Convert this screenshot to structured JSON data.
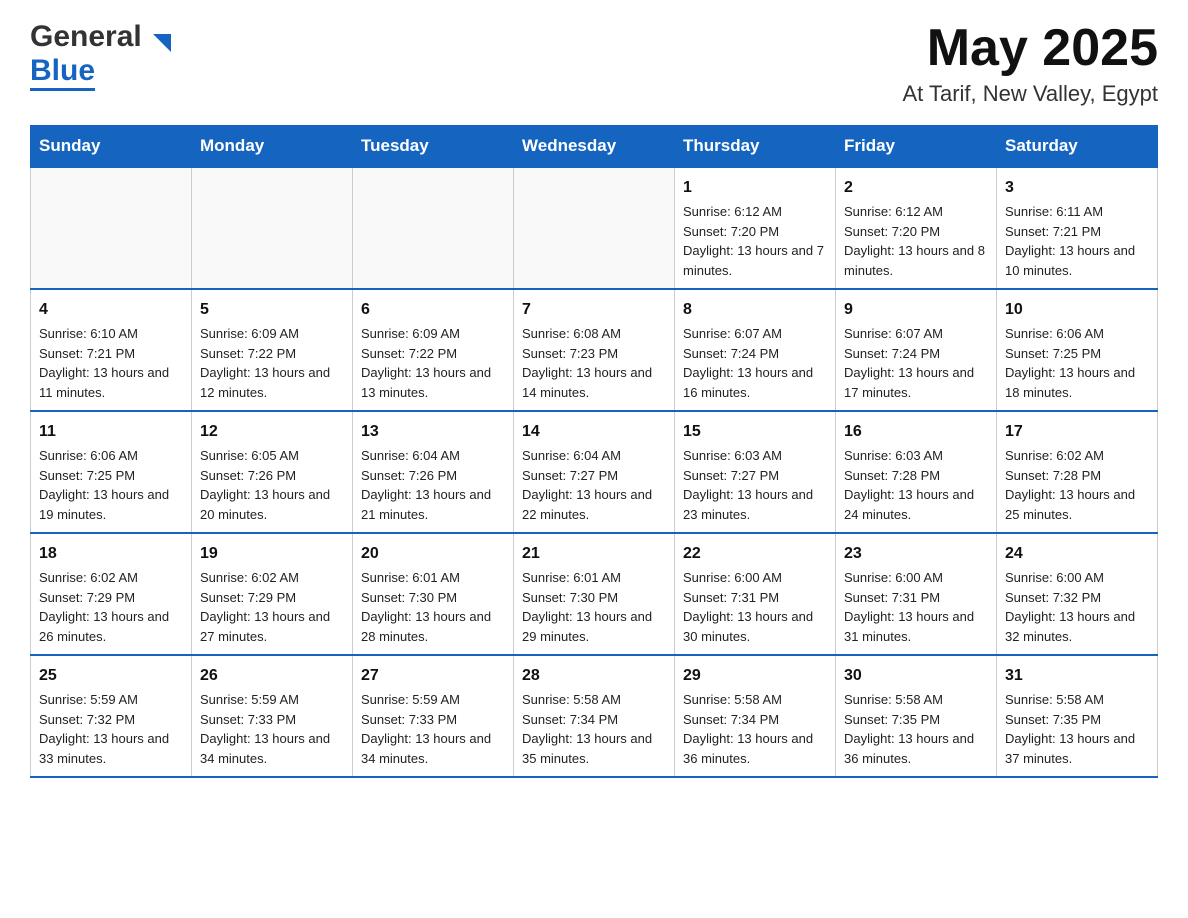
{
  "header": {
    "logo_general": "General",
    "logo_blue": "Blue",
    "title": "May 2025",
    "subtitle": "At Tarif, New Valley, Egypt"
  },
  "weekdays": [
    "Sunday",
    "Monday",
    "Tuesday",
    "Wednesday",
    "Thursday",
    "Friday",
    "Saturday"
  ],
  "weeks": [
    [
      {
        "day": "",
        "sunrise": "",
        "sunset": "",
        "daylight": ""
      },
      {
        "day": "",
        "sunrise": "",
        "sunset": "",
        "daylight": ""
      },
      {
        "day": "",
        "sunrise": "",
        "sunset": "",
        "daylight": ""
      },
      {
        "day": "",
        "sunrise": "",
        "sunset": "",
        "daylight": ""
      },
      {
        "day": "1",
        "sunrise": "Sunrise: 6:12 AM",
        "sunset": "Sunset: 7:20 PM",
        "daylight": "Daylight: 13 hours and 7 minutes."
      },
      {
        "day": "2",
        "sunrise": "Sunrise: 6:12 AM",
        "sunset": "Sunset: 7:20 PM",
        "daylight": "Daylight: 13 hours and 8 minutes."
      },
      {
        "day": "3",
        "sunrise": "Sunrise: 6:11 AM",
        "sunset": "Sunset: 7:21 PM",
        "daylight": "Daylight: 13 hours and 10 minutes."
      }
    ],
    [
      {
        "day": "4",
        "sunrise": "Sunrise: 6:10 AM",
        "sunset": "Sunset: 7:21 PM",
        "daylight": "Daylight: 13 hours and 11 minutes."
      },
      {
        "day": "5",
        "sunrise": "Sunrise: 6:09 AM",
        "sunset": "Sunset: 7:22 PM",
        "daylight": "Daylight: 13 hours and 12 minutes."
      },
      {
        "day": "6",
        "sunrise": "Sunrise: 6:09 AM",
        "sunset": "Sunset: 7:22 PM",
        "daylight": "Daylight: 13 hours and 13 minutes."
      },
      {
        "day": "7",
        "sunrise": "Sunrise: 6:08 AM",
        "sunset": "Sunset: 7:23 PM",
        "daylight": "Daylight: 13 hours and 14 minutes."
      },
      {
        "day": "8",
        "sunrise": "Sunrise: 6:07 AM",
        "sunset": "Sunset: 7:24 PM",
        "daylight": "Daylight: 13 hours and 16 minutes."
      },
      {
        "day": "9",
        "sunrise": "Sunrise: 6:07 AM",
        "sunset": "Sunset: 7:24 PM",
        "daylight": "Daylight: 13 hours and 17 minutes."
      },
      {
        "day": "10",
        "sunrise": "Sunrise: 6:06 AM",
        "sunset": "Sunset: 7:25 PM",
        "daylight": "Daylight: 13 hours and 18 minutes."
      }
    ],
    [
      {
        "day": "11",
        "sunrise": "Sunrise: 6:06 AM",
        "sunset": "Sunset: 7:25 PM",
        "daylight": "Daylight: 13 hours and 19 minutes."
      },
      {
        "day": "12",
        "sunrise": "Sunrise: 6:05 AM",
        "sunset": "Sunset: 7:26 PM",
        "daylight": "Daylight: 13 hours and 20 minutes."
      },
      {
        "day": "13",
        "sunrise": "Sunrise: 6:04 AM",
        "sunset": "Sunset: 7:26 PM",
        "daylight": "Daylight: 13 hours and 21 minutes."
      },
      {
        "day": "14",
        "sunrise": "Sunrise: 6:04 AM",
        "sunset": "Sunset: 7:27 PM",
        "daylight": "Daylight: 13 hours and 22 minutes."
      },
      {
        "day": "15",
        "sunrise": "Sunrise: 6:03 AM",
        "sunset": "Sunset: 7:27 PM",
        "daylight": "Daylight: 13 hours and 23 minutes."
      },
      {
        "day": "16",
        "sunrise": "Sunrise: 6:03 AM",
        "sunset": "Sunset: 7:28 PM",
        "daylight": "Daylight: 13 hours and 24 minutes."
      },
      {
        "day": "17",
        "sunrise": "Sunrise: 6:02 AM",
        "sunset": "Sunset: 7:28 PM",
        "daylight": "Daylight: 13 hours and 25 minutes."
      }
    ],
    [
      {
        "day": "18",
        "sunrise": "Sunrise: 6:02 AM",
        "sunset": "Sunset: 7:29 PM",
        "daylight": "Daylight: 13 hours and 26 minutes."
      },
      {
        "day": "19",
        "sunrise": "Sunrise: 6:02 AM",
        "sunset": "Sunset: 7:29 PM",
        "daylight": "Daylight: 13 hours and 27 minutes."
      },
      {
        "day": "20",
        "sunrise": "Sunrise: 6:01 AM",
        "sunset": "Sunset: 7:30 PM",
        "daylight": "Daylight: 13 hours and 28 minutes."
      },
      {
        "day": "21",
        "sunrise": "Sunrise: 6:01 AM",
        "sunset": "Sunset: 7:30 PM",
        "daylight": "Daylight: 13 hours and 29 minutes."
      },
      {
        "day": "22",
        "sunrise": "Sunrise: 6:00 AM",
        "sunset": "Sunset: 7:31 PM",
        "daylight": "Daylight: 13 hours and 30 minutes."
      },
      {
        "day": "23",
        "sunrise": "Sunrise: 6:00 AM",
        "sunset": "Sunset: 7:31 PM",
        "daylight": "Daylight: 13 hours and 31 minutes."
      },
      {
        "day": "24",
        "sunrise": "Sunrise: 6:00 AM",
        "sunset": "Sunset: 7:32 PM",
        "daylight": "Daylight: 13 hours and 32 minutes."
      }
    ],
    [
      {
        "day": "25",
        "sunrise": "Sunrise: 5:59 AM",
        "sunset": "Sunset: 7:32 PM",
        "daylight": "Daylight: 13 hours and 33 minutes."
      },
      {
        "day": "26",
        "sunrise": "Sunrise: 5:59 AM",
        "sunset": "Sunset: 7:33 PM",
        "daylight": "Daylight: 13 hours and 34 minutes."
      },
      {
        "day": "27",
        "sunrise": "Sunrise: 5:59 AM",
        "sunset": "Sunset: 7:33 PM",
        "daylight": "Daylight: 13 hours and 34 minutes."
      },
      {
        "day": "28",
        "sunrise": "Sunrise: 5:58 AM",
        "sunset": "Sunset: 7:34 PM",
        "daylight": "Daylight: 13 hours and 35 minutes."
      },
      {
        "day": "29",
        "sunrise": "Sunrise: 5:58 AM",
        "sunset": "Sunset: 7:34 PM",
        "daylight": "Daylight: 13 hours and 36 minutes."
      },
      {
        "day": "30",
        "sunrise": "Sunrise: 5:58 AM",
        "sunset": "Sunset: 7:35 PM",
        "daylight": "Daylight: 13 hours and 36 minutes."
      },
      {
        "day": "31",
        "sunrise": "Sunrise: 5:58 AM",
        "sunset": "Sunset: 7:35 PM",
        "daylight": "Daylight: 13 hours and 37 minutes."
      }
    ]
  ]
}
